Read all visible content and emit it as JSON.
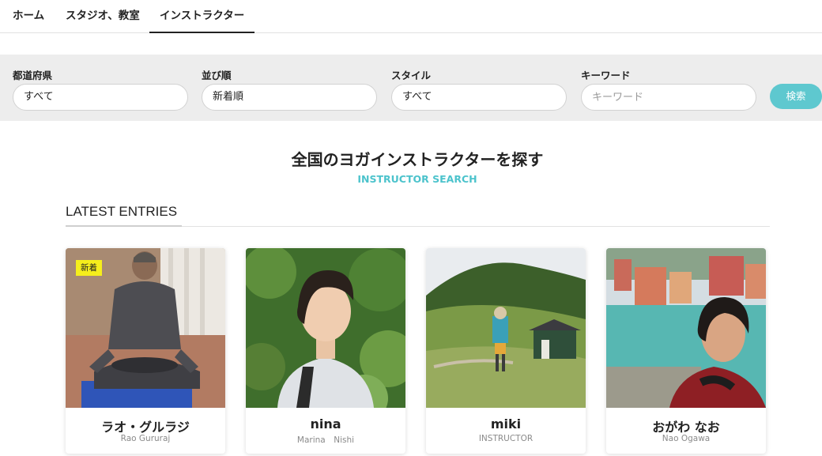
{
  "nav": {
    "tabs": [
      {
        "label": "ホーム"
      },
      {
        "label": "スタジオ、教室"
      },
      {
        "label": "インストラクター",
        "active": true
      }
    ]
  },
  "filters": {
    "prefecture": {
      "label": "都道府県",
      "value": "すべて"
    },
    "sort": {
      "label": "並び順",
      "value": "新着順"
    },
    "style": {
      "label": "スタイル",
      "value": "すべて"
    },
    "keyword": {
      "label": "キーワード",
      "placeholder": "キーワード",
      "value": ""
    },
    "search_button": "検索"
  },
  "hero": {
    "title": "全国のヨガインストラクターを探す",
    "subtitle": "INSTRUCTOR SEARCH"
  },
  "section": {
    "title": "LATEST ENTRIES"
  },
  "cards": [
    {
      "name": "ラオ・グルラジ",
      "sub": "Rao Gururaj",
      "badge": "新着",
      "photo": "man-in-meditation-pose"
    },
    {
      "name": "nina",
      "sub": "Marina　Nishi",
      "photo": "woman-portrait-greenery"
    },
    {
      "name": "miki",
      "sub": "INSTRUCTOR",
      "photo": "hiker-on-mountain-meadow"
    },
    {
      "name": "おがわ なお",
      "sub": "Nao Ogawa",
      "photo": "woman-selfie-by-river"
    }
  ],
  "colors": {
    "accent": "#5ec8cf",
    "badge": "#f5ee1c",
    "filter_bar": "#ededed"
  }
}
